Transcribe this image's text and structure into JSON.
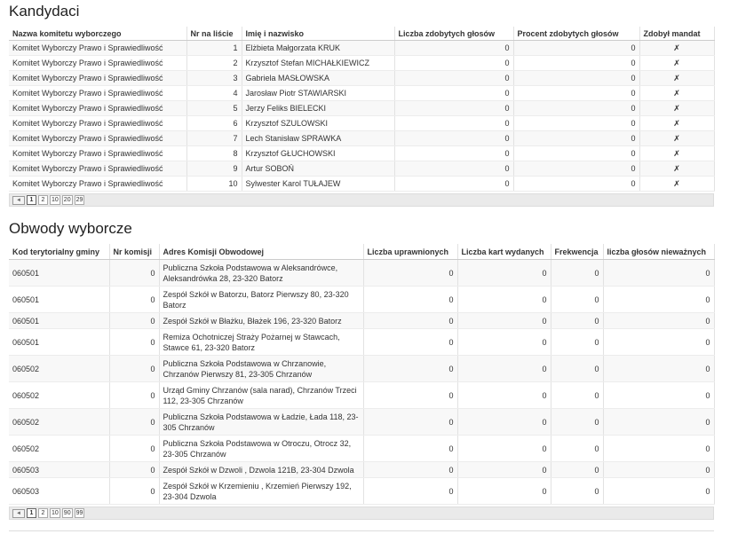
{
  "candidates": {
    "title": "Kandydaci",
    "headers": [
      "Nazwa komitetu wyborczego",
      "Nr na liście",
      "Imię i nazwisko",
      "Liczba zdobytych głosów",
      "Procent zdobytych głosów",
      "Zdobył mandat"
    ],
    "rows": [
      [
        "Komitet Wyborczy Prawo i Sprawiedliwość",
        "1",
        "Elżbieta Małgorzata KRUK",
        "0",
        "0",
        "✗"
      ],
      [
        "Komitet Wyborczy Prawo i Sprawiedliwość",
        "2",
        "Krzysztof Stefan MICHAŁKIEWICZ",
        "0",
        "0",
        "✗"
      ],
      [
        "Komitet Wyborczy Prawo i Sprawiedliwość",
        "3",
        "Gabriela MASŁOWSKA",
        "0",
        "0",
        "✗"
      ],
      [
        "Komitet Wyborczy Prawo i Sprawiedliwość",
        "4",
        "Jarosław Piotr STAWIARSKI",
        "0",
        "0",
        "✗"
      ],
      [
        "Komitet Wyborczy Prawo i Sprawiedliwość",
        "5",
        "Jerzy Feliks BIELECKI",
        "0",
        "0",
        "✗"
      ],
      [
        "Komitet Wyborczy Prawo i Sprawiedliwość",
        "6",
        "Krzysztof SZULOWSKI",
        "0",
        "0",
        "✗"
      ],
      [
        "Komitet Wyborczy Prawo i Sprawiedliwość",
        "7",
        "Lech Stanisław SPRAWKA",
        "0",
        "0",
        "✗"
      ],
      [
        "Komitet Wyborczy Prawo i Sprawiedliwość",
        "8",
        "Krzysztof GŁUCHOWSKI",
        "0",
        "0",
        "✗"
      ],
      [
        "Komitet Wyborczy Prawo i Sprawiedliwość",
        "9",
        "Artur SOBOŃ",
        "0",
        "0",
        "✗"
      ],
      [
        "Komitet Wyborczy Prawo i Sprawiedliwość",
        "10",
        "Sylwester Karol TUŁAJEW",
        "0",
        "0",
        "✗"
      ]
    ],
    "pager": [
      "1",
      "2",
      "10",
      "20",
      "29"
    ]
  },
  "districts": {
    "title": "Obwody wyborcze",
    "headers": [
      "Kod terytorialny gminy",
      "Nr komisji",
      "Adres Komisji Obwodowej",
      "Liczba uprawnionych",
      "Liczba kart wydanych",
      "Frekwencja",
      "liczba głosów nieważnych"
    ],
    "rows": [
      [
        "060501",
        "0",
        "Publiczna Szkoła Podstawowa w Aleksandrówce, Aleksandrówka 28, 23-320 Batorz",
        "0",
        "0",
        "0",
        "0"
      ],
      [
        "060501",
        "0",
        "Zespół Szkół w Batorzu, Batorz Pierwszy 80, 23-320 Batorz",
        "0",
        "0",
        "0",
        "0"
      ],
      [
        "060501",
        "0",
        "Zespół Szkół w Błażku, Błażek 196, 23-320 Batorz",
        "0",
        "0",
        "0",
        "0"
      ],
      [
        "060501",
        "0",
        "Remiza Ochotniczej Straży Pożarnej w Stawcach, Stawce 61, 23-320 Batorz",
        "0",
        "0",
        "0",
        "0"
      ],
      [
        "060502",
        "0",
        "Publiczna Szkoła Podstawowa w Chrzanowie, Chrzanów Pierwszy 81, 23-305 Chrzanów",
        "0",
        "0",
        "0",
        "0"
      ],
      [
        "060502",
        "0",
        "Urząd Gminy Chrzanów (sala narad), Chrzanów Trzeci 112, 23-305 Chrzanów",
        "0",
        "0",
        "0",
        "0"
      ],
      [
        "060502",
        "0",
        "Publiczna Szkoła Podstawowa w Ładzie, Łada 118, 23-305 Chrzanów",
        "0",
        "0",
        "0",
        "0"
      ],
      [
        "060502",
        "0",
        "Publiczna Szkoła Podstawowa w Otroczu, Otrocz 32, 23-305 Chrzanów",
        "0",
        "0",
        "0",
        "0"
      ],
      [
        "060503",
        "0",
        "Zespół Szkół w Dzwoli , Dzwola 121B, 23-304 Dzwola",
        "0",
        "0",
        "0",
        "0"
      ],
      [
        "060503",
        "0",
        "Zespół Szkół w Krzemieniu , Krzemień Pierwszy 192, 23-304 Dzwola",
        "0",
        "0",
        "0",
        "0"
      ]
    ],
    "pager": [
      "1",
      "2",
      "10",
      "90",
      "99"
    ]
  }
}
